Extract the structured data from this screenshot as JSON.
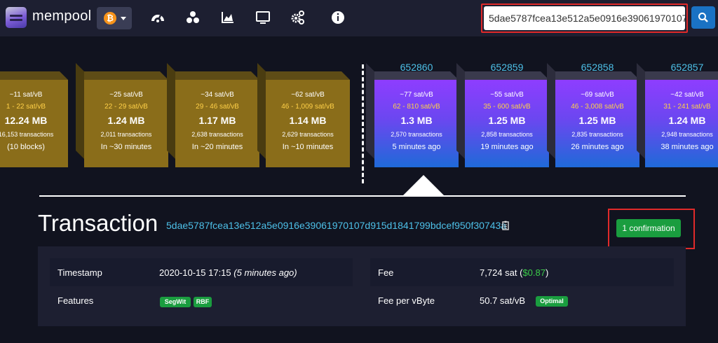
{
  "navbar": {
    "brand": "mempool",
    "network_symbol": "₿",
    "icons": [
      "dashboard-icon",
      "graph-icon",
      "chart-icon",
      "tv-icon",
      "cogs-icon",
      "info-icon"
    ],
    "search": {
      "value": "5dae5787fcea13e512a5e0916e390619701070"
    }
  },
  "mempool_blocks": [
    {
      "fee": "~11 sat/vB",
      "range": "1 - 22 sat/vB",
      "size": "12.24 MB",
      "txs": "16,153 transactions",
      "time": "(10 blocks)"
    },
    {
      "fee": "~25 sat/vB",
      "range": "22 - 29 sat/vB",
      "size": "1.24 MB",
      "txs": "2,011 transactions",
      "time": "In ~30 minutes"
    },
    {
      "fee": "~34 sat/vB",
      "range": "29 - 46 sat/vB",
      "size": "1.17 MB",
      "txs": "2,638 transactions",
      "time": "In ~20 minutes"
    },
    {
      "fee": "~62 sat/vB",
      "range": "46 - 1,009 sat/vB",
      "size": "1.14 MB",
      "txs": "2,629 transactions",
      "time": "In ~10 minutes"
    }
  ],
  "blocks": [
    {
      "height": "652860",
      "fee": "~77 sat/vB",
      "range": "62 - 810 sat/vB",
      "size": "1.3 MB",
      "txs": "2,570 transactions",
      "time": "5 minutes ago"
    },
    {
      "height": "652859",
      "fee": "~55 sat/vB",
      "range": "35 - 600 sat/vB",
      "size": "1.25 MB",
      "txs": "2,858 transactions",
      "time": "19 minutes ago"
    },
    {
      "height": "652858",
      "fee": "~69 sat/vB",
      "range": "46 - 3,008 sat/vB",
      "size": "1.25 MB",
      "txs": "2,835 transactions",
      "time": "26 minutes ago"
    },
    {
      "height": "652857",
      "fee": "~42 sat/vB",
      "range": "31 - 241 sat/vB",
      "size": "1.24 MB",
      "txs": "2,948 transactions",
      "time": "38 minutes ago"
    }
  ],
  "transaction": {
    "title": "Transaction",
    "txid": "5dae5787fcea13e512a5e0916e39061970107d915d1841799bdcef950f30743a",
    "confirmations": "1 confirmation",
    "timestamp_label": "Timestamp",
    "timestamp_value": "2020-10-15 17:15",
    "timestamp_relative": "(5 minutes ago)",
    "features_label": "Features",
    "features": [
      "SegWit",
      "RBF"
    ],
    "fee_label": "Fee",
    "fee_sat": "7,724 sat",
    "fee_fiat": "$0.87",
    "fee_rate_label": "Fee per vByte",
    "fee_rate_value": "50.7 sat/vB",
    "fee_rate_tag": "Optimal"
  },
  "colors": {
    "background": "#11131f",
    "navbar": "#1d1f31",
    "accent_link": "#4dc0e8",
    "confirm_green": "#1a9d3f",
    "highlight_red": "#e02a2a"
  }
}
